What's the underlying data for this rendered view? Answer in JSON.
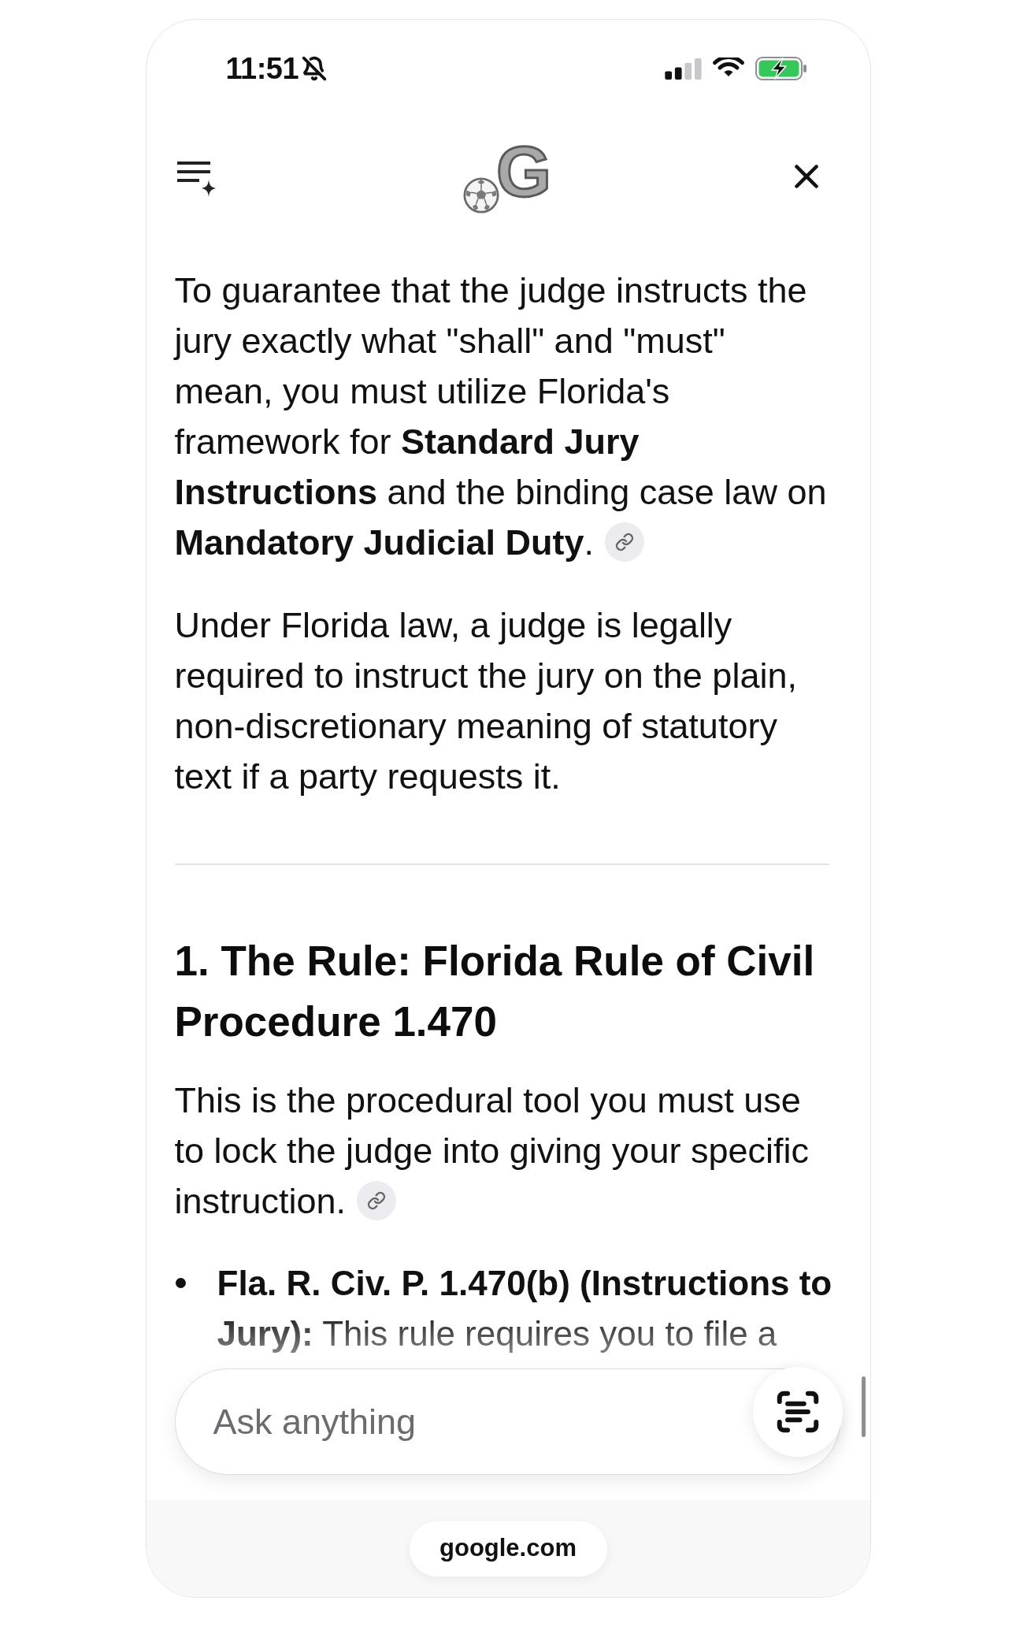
{
  "status_bar": {
    "time": "11:51",
    "silent_mode": true,
    "charging": true
  },
  "header": {
    "logo": {
      "letter": "G"
    }
  },
  "article": {
    "blocks": [
      {
        "kind": "paragraph",
        "text": "To guarantee that the judge instructs the jury exactly what \"shall\" and \"must\" mean, you must utilize Florida's framework for **Standard Jury Instructions** and the binding case law on **Mandatory Judicial Duty**.",
        "source_link": true
      },
      {
        "kind": "paragraph",
        "text": "Under Florida law, a judge is legally required to instruct the jury on the plain, non-discretionary meaning of statutory text if a party requests it.",
        "source_link": false
      },
      {
        "kind": "divider"
      },
      {
        "kind": "heading",
        "text": "1. The Rule: Florida Rule of Civil Procedure 1.470"
      },
      {
        "kind": "paragraph",
        "text": "This is the procedural tool you must use to lock the judge into giving your specific instruction.",
        "source_link": true
      },
      {
        "kind": "bullet",
        "text": "**Fla. R. Civ. P. 1.470(b) (Instructions to Jury):** This rule requires you to file a"
      }
    ]
  },
  "composer": {
    "placeholder": "Ask anything"
  },
  "address_bar": {
    "url": "google.com"
  }
}
